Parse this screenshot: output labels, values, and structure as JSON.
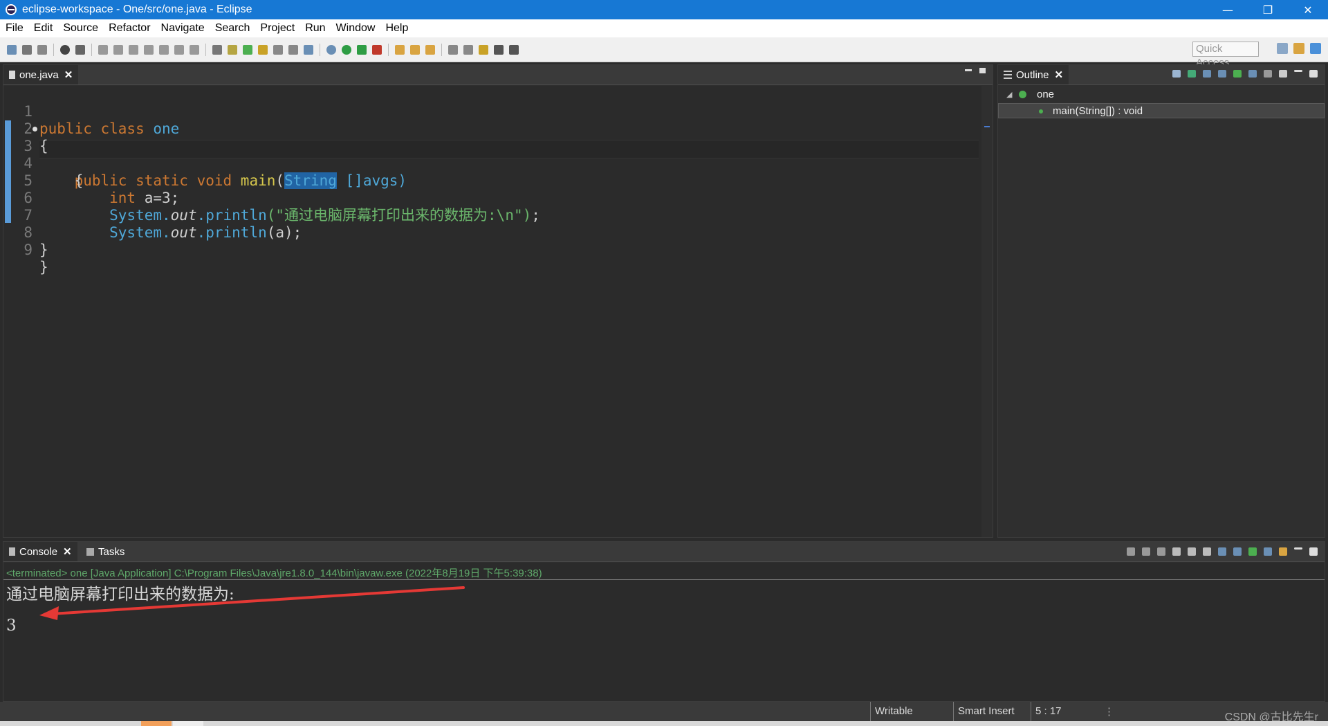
{
  "window": {
    "title": "eclipse-workspace - One/src/one.java - Eclipse",
    "minimize": "—",
    "restore": "❐",
    "close": "✕"
  },
  "menu": [
    "File",
    "Edit",
    "Source",
    "Refactor",
    "Navigate",
    "Search",
    "Project",
    "Run",
    "Window",
    "Help"
  ],
  "toolbar": {
    "quick_access": "Quick Access"
  },
  "editor": {
    "tab_label": "one.java",
    "line_numbers": [
      "1",
      "2",
      "3",
      "4",
      "5",
      "6",
      "7",
      "8",
      "9"
    ],
    "lines": {
      "l1": {
        "kw": "public class ",
        "name": "one"
      },
      "l2": "{",
      "l3": {
        "kw": "    public static void ",
        "fn": "main",
        "paren": "(",
        "sel": "String",
        "rest": " []avgs)"
      },
      "l4": "    {",
      "l5": {
        "kw": "        int ",
        "rest": "a=3;"
      },
      "l6": {
        "cls": "        System.",
        "out": "out",
        "fn": ".println",
        "str": "(\"通过电脑屏幕打印出来的数据为:\\n\")",
        "end": ";"
      },
      "l7": {
        "cls": "        System.",
        "out": "out",
        "fn": ".println",
        "rest": "(a);"
      },
      "l8": "}",
      "l9": "}"
    }
  },
  "outline": {
    "tab_label": "Outline",
    "class_name": "one",
    "method": "main(String[]) : void"
  },
  "console": {
    "tab_label": "Console",
    "tasks_label": "Tasks",
    "terminated": "<terminated> one [Java Application] C:\\Program Files\\Java\\jre1.8.0_144\\bin\\javaw.exe (2022年8月19日 下午5:39:38)",
    "output_line1": "通过电脑屏幕打印出来的数据为:",
    "output_line2": "3"
  },
  "status": {
    "writable": "Writable",
    "insert_mode": "Smart Insert",
    "position": "5 : 17",
    "watermark": "CSDN @古比先生r"
  },
  "colors": {
    "accent": "#1778d4",
    "annotation_arrow": "#e53935"
  }
}
